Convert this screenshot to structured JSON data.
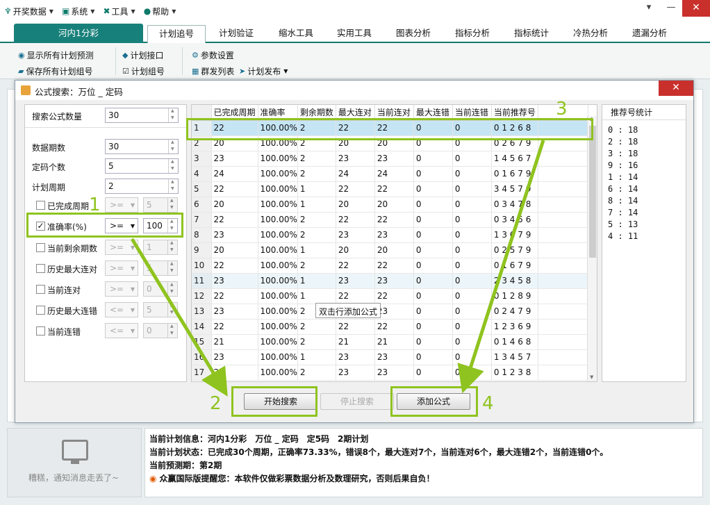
{
  "menubar": {
    "items": [
      {
        "label": "开奖数据",
        "icon": "trophy-icon"
      },
      {
        "label": "系统",
        "icon": "monitor-icon"
      },
      {
        "label": "工具",
        "icon": "tools-icon"
      },
      {
        "label": "帮助",
        "icon": "help-icon"
      }
    ],
    "win_buttons": [
      "▾",
      "—",
      "✕"
    ]
  },
  "tabs": {
    "primary": "河内1分彩",
    "items": [
      "计划追号",
      "计划验证",
      "缩水工具",
      "实用工具",
      "图表分析",
      "指标分析",
      "指标统计",
      "冷热分析",
      "遗漏分析"
    ],
    "active": "计划追号"
  },
  "toolbar": {
    "show_all_predict": "显示所有计划预测",
    "save_all_groups": "保存所有计划组号",
    "plan_interface": "计划接口",
    "plan_group": "计划组号",
    "param_settings": "参数设置",
    "group_send_list": "群发列表",
    "plan_publish": "计划发布"
  },
  "dialog": {
    "title": "公式搜索：万位 _ 定码",
    "close": "✕",
    "params": {
      "search_count_label": "搜索公式数量",
      "search_count_value": "30",
      "data_periods_label": "数据期数",
      "data_periods_value": "30",
      "code_count_label": "定码个数",
      "code_count_value": "5",
      "plan_period_label": "计划周期",
      "plan_period_value": "2",
      "filters": [
        {
          "label": "已完成周期",
          "checked": false,
          "op": ">=",
          "value": "5"
        },
        {
          "label": "准确率(%)",
          "checked": true,
          "op": ">=",
          "value": "100"
        },
        {
          "label": "当前剩余期数",
          "checked": false,
          "op": ">=",
          "value": "1"
        },
        {
          "label": "历史最大连对",
          "checked": false,
          "op": ">=",
          "value": "5"
        },
        {
          "label": "当前连对",
          "checked": false,
          "op": ">=",
          "value": "0"
        },
        {
          "label": "历史最大连错",
          "checked": false,
          "op": "<=",
          "value": "5"
        },
        {
          "label": "当前连错",
          "checked": false,
          "op": "<=",
          "value": "0"
        }
      ]
    },
    "grid": {
      "columns": [
        "已完成周期",
        "准确率",
        "剩余期数",
        "最大连对",
        "当前连对",
        "最大连错",
        "当前连错",
        "当前推荐号"
      ],
      "rows": [
        [
          "1",
          "22",
          "100.00%",
          "2",
          "22",
          "22",
          "0",
          "0",
          "0 1 2 6 8"
        ],
        [
          "2",
          "20",
          "100.00%",
          "2",
          "20",
          "20",
          "0",
          "0",
          "0 2 6 7 9"
        ],
        [
          "3",
          "23",
          "100.00%",
          "2",
          "23",
          "23",
          "0",
          "0",
          "1 4 5 6 7"
        ],
        [
          "4",
          "24",
          "100.00%",
          "2",
          "24",
          "24",
          "0",
          "0",
          "0 1 6 7 9"
        ],
        [
          "5",
          "22",
          "100.00%",
          "1",
          "22",
          "22",
          "0",
          "0",
          "3 4 5 7 9"
        ],
        [
          "6",
          "20",
          "100.00%",
          "1",
          "20",
          "20",
          "0",
          "0",
          "0 3 4 7 8"
        ],
        [
          "7",
          "22",
          "100.00%",
          "2",
          "22",
          "22",
          "0",
          "0",
          "0 3 4 5 6"
        ],
        [
          "8",
          "23",
          "100.00%",
          "2",
          "23",
          "23",
          "0",
          "0",
          "1 3 6 7 9"
        ],
        [
          "9",
          "20",
          "100.00%",
          "1",
          "20",
          "20",
          "0",
          "0",
          "0 2 5 7 9"
        ],
        [
          "10",
          "22",
          "100.00%",
          "2",
          "22",
          "22",
          "0",
          "0",
          "0 1 6 7 9"
        ],
        [
          "11",
          "23",
          "100.00%",
          "1",
          "23",
          "23",
          "0",
          "0",
          "2 3 4 5 8"
        ],
        [
          "12",
          "22",
          "100.00%",
          "1",
          "22",
          "22",
          "0",
          "0",
          "0 1 2 8 9"
        ],
        [
          "13",
          "23",
          "100.00%",
          "2",
          "",
          "23",
          "0",
          "0",
          "0 2 4 7 9"
        ],
        [
          "14",
          "22",
          "100.00%",
          "2",
          "22",
          "22",
          "0",
          "0",
          "1 2 3 6 9"
        ],
        [
          "15",
          "21",
          "100.00%",
          "2",
          "21",
          "21",
          "0",
          "0",
          "0 1 4 6 8"
        ],
        [
          "16",
          "23",
          "100.00%",
          "1",
          "23",
          "23",
          "0",
          "0",
          "1 3 4 5 7"
        ],
        [
          "17",
          "23",
          "100.00%",
          "2",
          "23",
          "23",
          "0",
          "0",
          "0 1 2 3 8"
        ]
      ],
      "tooltip": "双击行添加公式"
    },
    "stats": {
      "header": "推荐号统计",
      "rows": [
        "0 : 18",
        "2 : 18",
        "3 : 18",
        "9 : 16",
        "1 : 14",
        "6 : 14",
        "8 : 14",
        "7 : 14",
        "5 : 13",
        "4 : 11"
      ]
    },
    "buttons": {
      "start_search": "开始搜索",
      "stop_search": "停止搜索",
      "add_formula": "添加公式"
    }
  },
  "annotations": {
    "n1": "1",
    "n2": "2",
    "n3": "3",
    "n4": "4",
    "color": "#8fc31f"
  },
  "bottom": {
    "line1": "当前计划信息：河内1分彩　万位 _ 定码　定5码　2期计划",
    "line2": "当前计划状态：已完成30个周期，正确率73.33%，错误8个，最大连对7个，当前连对6个，最大连错2个，当前连错0个。",
    "line3": "当前预测期：第2期",
    "line4": "众赢国际版提醒您：本软件仅做彩票数据分析及数理研究，否则后果自负！",
    "notice": "糟糕，通知消息走丢了~"
  }
}
